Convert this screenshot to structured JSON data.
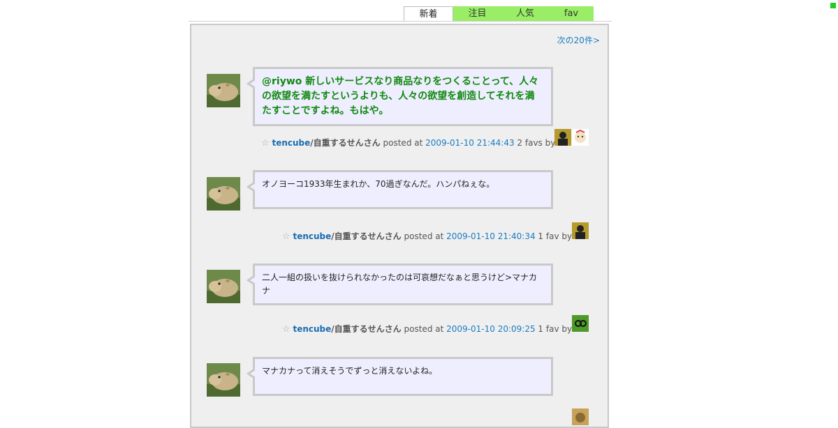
{
  "tabs": [
    {
      "label": "新着",
      "active": true
    },
    {
      "label": "注目",
      "active": false
    },
    {
      "label": "人気",
      "active": false
    },
    {
      "label": "fav",
      "active": false
    }
  ],
  "next_label": "次の20件>",
  "colors": {
    "tab_green": "#99ee66",
    "link_blue": "#1b7bc2",
    "bubble_bg": "#eeeefe",
    "highlight_green": "#118811"
  },
  "posts": [
    {
      "mention": "@riywo",
      "text": " 新しいサービスなり商品なりをつくることって、人々の欲望を満たすというよりも、人々の欲望を創造してそれを満たすことですよね。もはや。",
      "user": "tencube",
      "name": "/自重するせんさん",
      "posted_at_label": "posted at",
      "date": "2009-01-10 21:44:43",
      "favs": "2 favs by"
    },
    {
      "text": "オノヨーコ1933年生まれか、70過ぎなんだ。ハンパねぇな。",
      "user": "tencube",
      "name": "/自重するせんさん",
      "posted_at_label": "posted at",
      "date": "2009-01-10 21:40:34",
      "favs": "1 fav by"
    },
    {
      "text": "二人一組の扱いを抜けられなかったのは可哀想だなぁと思うけど>マナカナ",
      "user": "tencube",
      "name": "/自重するせんさん",
      "posted_at_label": "posted at",
      "date": "2009-01-10 20:09:25",
      "favs": "1 fav by"
    },
    {
      "text": "マナカナって消えそうでずっと消えないよね。"
    }
  ]
}
